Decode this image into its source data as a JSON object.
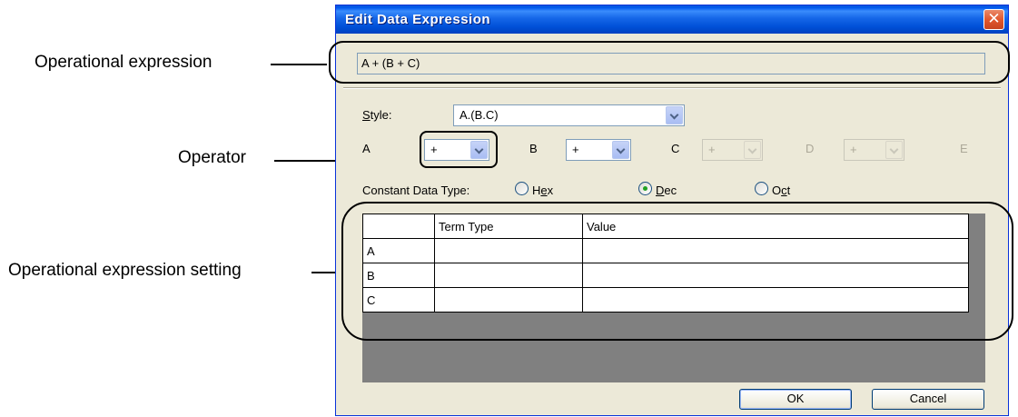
{
  "window": {
    "title": "Edit Data Expression",
    "close_icon": "close-icon"
  },
  "expression": {
    "value": "A + (B + C)"
  },
  "style": {
    "label": "Style:",
    "value": "A.(B.C)"
  },
  "operators": [
    {
      "term": "A",
      "value": "+",
      "enabled": true
    },
    {
      "term": "B",
      "value": "+",
      "enabled": true
    },
    {
      "term": "C",
      "value": "+",
      "enabled": false
    },
    {
      "term": "D",
      "value": "+",
      "enabled": false
    },
    {
      "term": "E",
      "enabled": false
    }
  ],
  "constant_type": {
    "label": "Constant Data Type:",
    "options": [
      {
        "label": "Hex",
        "checked": false
      },
      {
        "label": "Dec",
        "checked": true
      },
      {
        "label": "Oct",
        "checked": false
      }
    ]
  },
  "grid": {
    "headers": [
      "",
      "Term Type",
      "Value"
    ],
    "rows": [
      {
        "label": "A",
        "term_type": "",
        "value": ""
      },
      {
        "label": "B",
        "term_type": "",
        "value": ""
      },
      {
        "label": "C",
        "term_type": "",
        "value": ""
      }
    ]
  },
  "buttons": {
    "ok": "OK",
    "cancel": "Cancel"
  },
  "callouts": {
    "expression": "Operational expression",
    "operator": "Operator",
    "setting": "Operational expression setting"
  }
}
